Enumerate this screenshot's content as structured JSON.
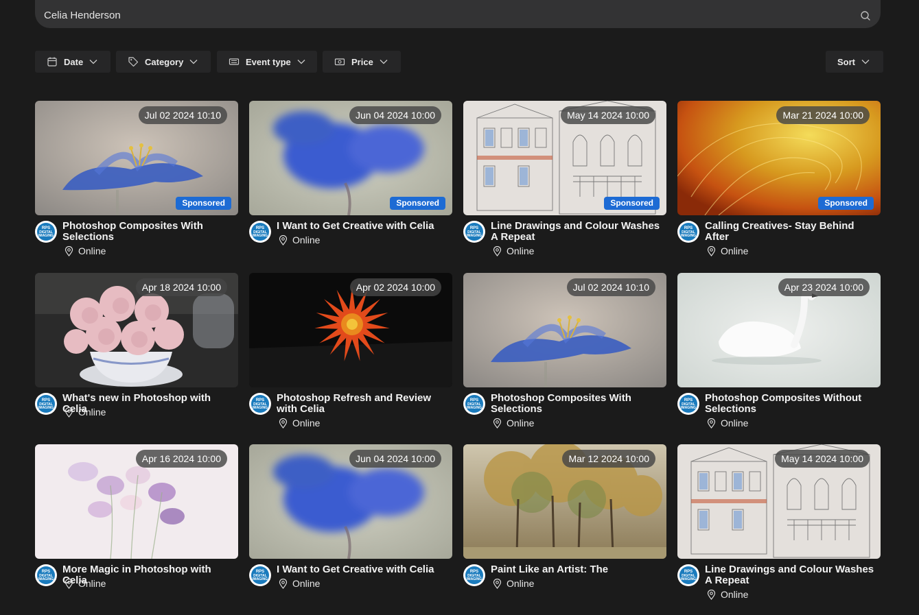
{
  "search": {
    "value": "Celia Henderson",
    "placeholder": ""
  },
  "filters": [
    {
      "label": "Date",
      "icon": "calendar-icon"
    },
    {
      "label": "Category",
      "icon": "tag-icon"
    },
    {
      "label": "Event type",
      "icon": "ticket-icon"
    },
    {
      "label": "Price",
      "icon": "money-icon"
    }
  ],
  "sort": {
    "label": "Sort"
  },
  "organizer": {
    "badge_line1": "RPS",
    "badge_line2": "DIGITAL",
    "badge_line3": "IMAGING"
  },
  "events": [
    {
      "date": "Jul 02 2024 10:10",
      "title": "Photoshop Composites With Selections",
      "location": "Online",
      "sponsored": "Sponsored",
      "art": "blue-flower"
    },
    {
      "date": "Jun 04 2024 10:00",
      "title": "I Want to Get Creative with Celia",
      "location": "Online",
      "sponsored": "Sponsored",
      "art": "blue-blur"
    },
    {
      "date": "May 14 2024 10:00",
      "title": "Line Drawings and Colour Washes A Repeat",
      "location": "Online",
      "sponsored": "Sponsored",
      "art": "sketch"
    },
    {
      "date": "Mar 21 2024 10:00",
      "title": "Calling Creatives- Stay Behind After",
      "location": "Online",
      "sponsored": "Sponsored",
      "art": "swirl"
    },
    {
      "date": "Apr 18 2024 10:00",
      "title": "What's new in Photoshop with Celia",
      "location": "Online",
      "sponsored": "",
      "art": "carnations"
    },
    {
      "date": "Apr 02 2024 10:00",
      "title": "Photoshop Refresh and Review with Celia",
      "location": "Online",
      "sponsored": "",
      "art": "dahlia"
    },
    {
      "date": "Jul 02 2024 10:10",
      "title": "Photoshop Composites With Selections",
      "location": "Online",
      "sponsored": "",
      "art": "blue-flower"
    },
    {
      "date": "Apr 23 2024 10:00",
      "title": "Photoshop Composites Without Selections",
      "location": "Online",
      "sponsored": "",
      "art": "swan"
    },
    {
      "date": "Apr 16 2024 10:00",
      "title": "More Magic in Photoshop with Celia",
      "location": "Online",
      "sponsored": "",
      "art": "sweetpeas"
    },
    {
      "date": "Jun 04 2024 10:00",
      "title": "I Want to Get Creative with Celia",
      "location": "Online",
      "sponsored": "",
      "art": "blue-blur"
    },
    {
      "date": "Mar 12 2024 10:00",
      "title": "Paint Like an Artist:  The",
      "location": "Online",
      "sponsored": "",
      "art": "trees"
    },
    {
      "date": "May 14 2024 10:00",
      "title": "Line Drawings and Colour Washes A Repeat",
      "location": "Online",
      "sponsored": "",
      "art": "sketch"
    }
  ],
  "colors": {
    "background": "#1b1b1b",
    "sponsored_badge": "#1d6bd4",
    "organizer_badge": "#1a7bbd"
  }
}
